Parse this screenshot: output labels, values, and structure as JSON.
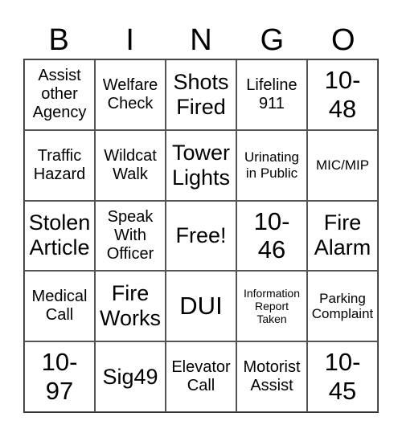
{
  "header": [
    "B",
    "I",
    "N",
    "G",
    "O"
  ],
  "cells": [
    {
      "text": "Assist\nother\nAgency",
      "size": "m"
    },
    {
      "text": "Welfare\nCheck",
      "size": "m"
    },
    {
      "text": "Shots\nFired",
      "size": "l"
    },
    {
      "text": "Lifeline\n911",
      "size": "m"
    },
    {
      "text": "10-\n48",
      "size": "xl"
    },
    {
      "text": "Traffic\nHazard",
      "size": "m"
    },
    {
      "text": "Wildcat\nWalk",
      "size": "m"
    },
    {
      "text": "Tower\nLights",
      "size": "l"
    },
    {
      "text": "Urinating\nin Public",
      "size": "s"
    },
    {
      "text": "MIC/MIP",
      "size": "s"
    },
    {
      "text": "Stolen\nArticle",
      "size": "l"
    },
    {
      "text": "Speak\nWith\nOfficer",
      "size": "m"
    },
    {
      "text": "Free!",
      "size": "l"
    },
    {
      "text": "10-\n46",
      "size": "xl"
    },
    {
      "text": "Fire\nAlarm",
      "size": "l"
    },
    {
      "text": "Medical\nCall",
      "size": "m"
    },
    {
      "text": "Fire\nWorks",
      "size": "l"
    },
    {
      "text": "DUI",
      "size": "xl"
    },
    {
      "text": "Information\nReport\nTaken",
      "size": "xs"
    },
    {
      "text": "Parking\nComplaint",
      "size": "s"
    },
    {
      "text": "10-\n97",
      "size": "xl"
    },
    {
      "text": "Sig49",
      "size": "l"
    },
    {
      "text": "Elevator\nCall",
      "size": "m"
    },
    {
      "text": "Motorist\nAssist",
      "size": "m"
    },
    {
      "text": "10-\n45",
      "size": "xl"
    }
  ]
}
